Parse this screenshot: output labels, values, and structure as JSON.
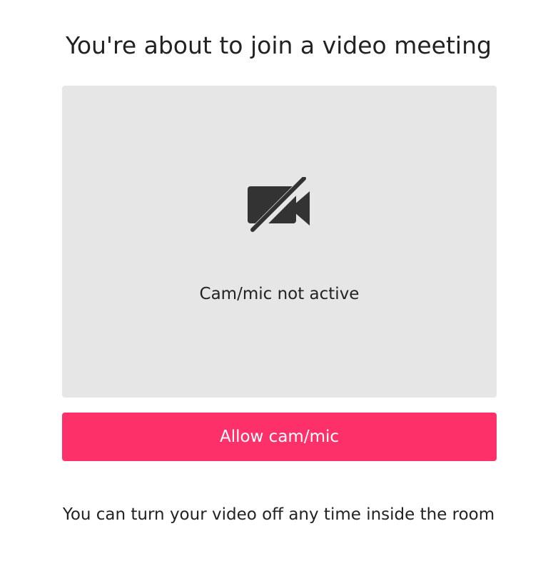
{
  "page": {
    "title": "You're about to join a video meeting"
  },
  "preview": {
    "icon": "camera-off-icon",
    "status_text": "Cam/mic not active",
    "background_color": "#e6e6e6"
  },
  "actions": {
    "allow_label": "Allow cam/mic",
    "accent_color": "#fd3069"
  },
  "footer": {
    "note": "You can turn your video off any time inside the room"
  }
}
